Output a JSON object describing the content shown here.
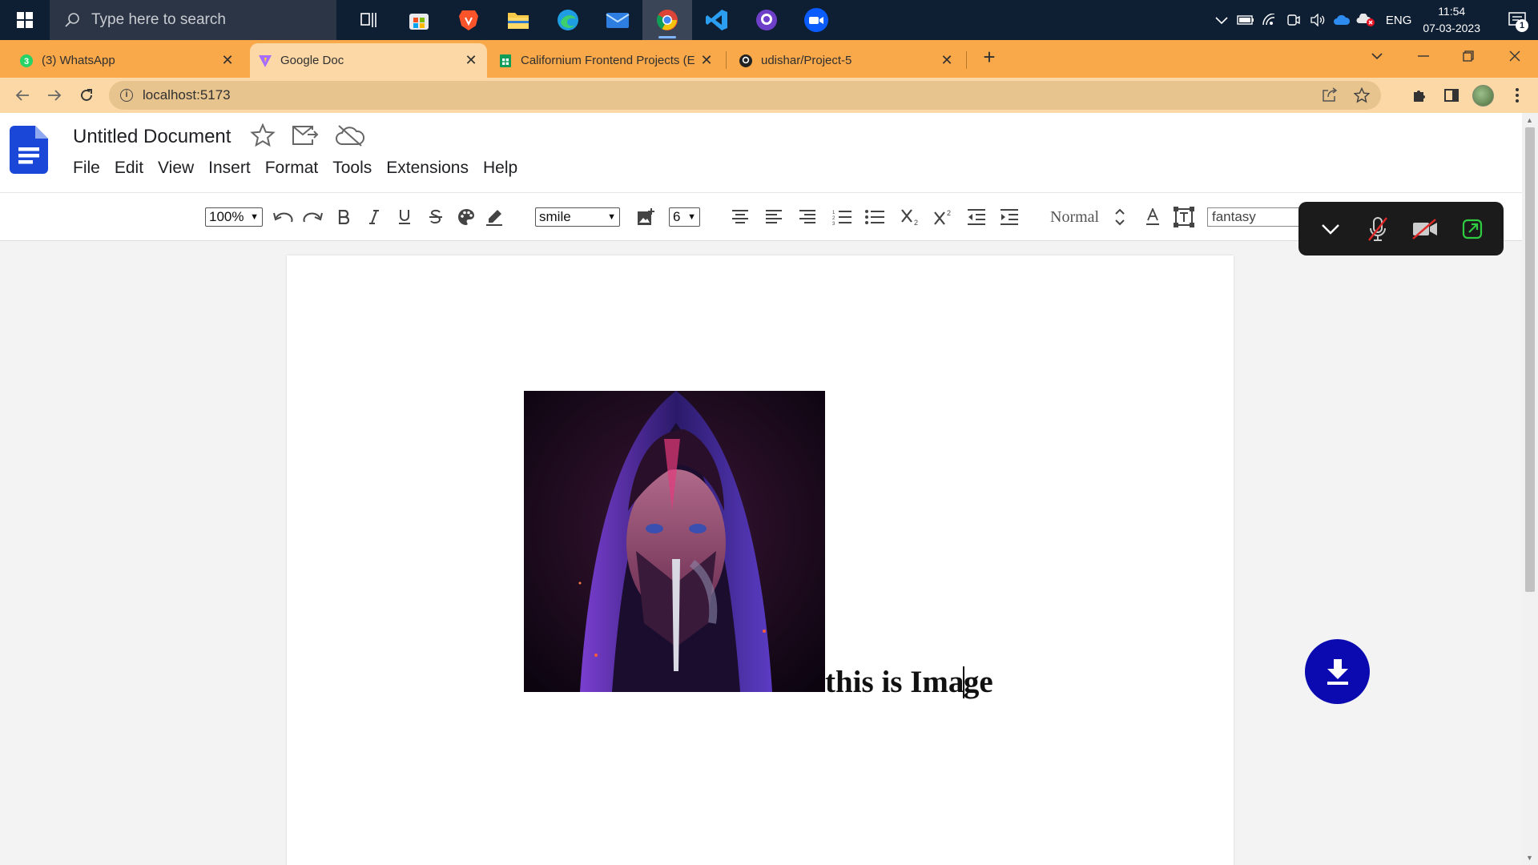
{
  "taskbar": {
    "search_placeholder": "Type here to search",
    "apps": [
      "task-view",
      "microsoft-store",
      "brave",
      "file-explorer",
      "edge",
      "mail",
      "chrome",
      "vscode",
      "github-desktop",
      "zoom"
    ],
    "language": "ENG",
    "time": "11:54",
    "date": "07-03-2023",
    "notification_count": "1"
  },
  "browser": {
    "tabs": [
      {
        "title": "(3) WhatsApp",
        "icon": "whatsapp-icon",
        "active": false
      },
      {
        "title": "Google Doc",
        "icon": "vite-icon",
        "active": true
      },
      {
        "title": "Californium Frontend Projects (E",
        "icon": "sheets-icon",
        "active": false
      },
      {
        "title": "udishar/Project-5",
        "icon": "github-icon",
        "active": false
      }
    ],
    "url": "localhost:5173",
    "new_tab_glyph": "+",
    "accent_color": "#f9a84a"
  },
  "doc": {
    "title": "Untitled Document",
    "menu": [
      "File",
      "Edit",
      "View",
      "Insert",
      "Format",
      "Tools",
      "Extensions",
      "Help"
    ],
    "toolbar": {
      "zoom": "100%",
      "emoji_select": "smile",
      "font_size_select": "6",
      "style": "Normal",
      "font_family": "fantasy"
    },
    "body_text_before_caret": "this is Ima",
    "body_text_after_caret": "ge",
    "brand_color": "#1a47d8",
    "download_color": "#0a0ab0"
  }
}
